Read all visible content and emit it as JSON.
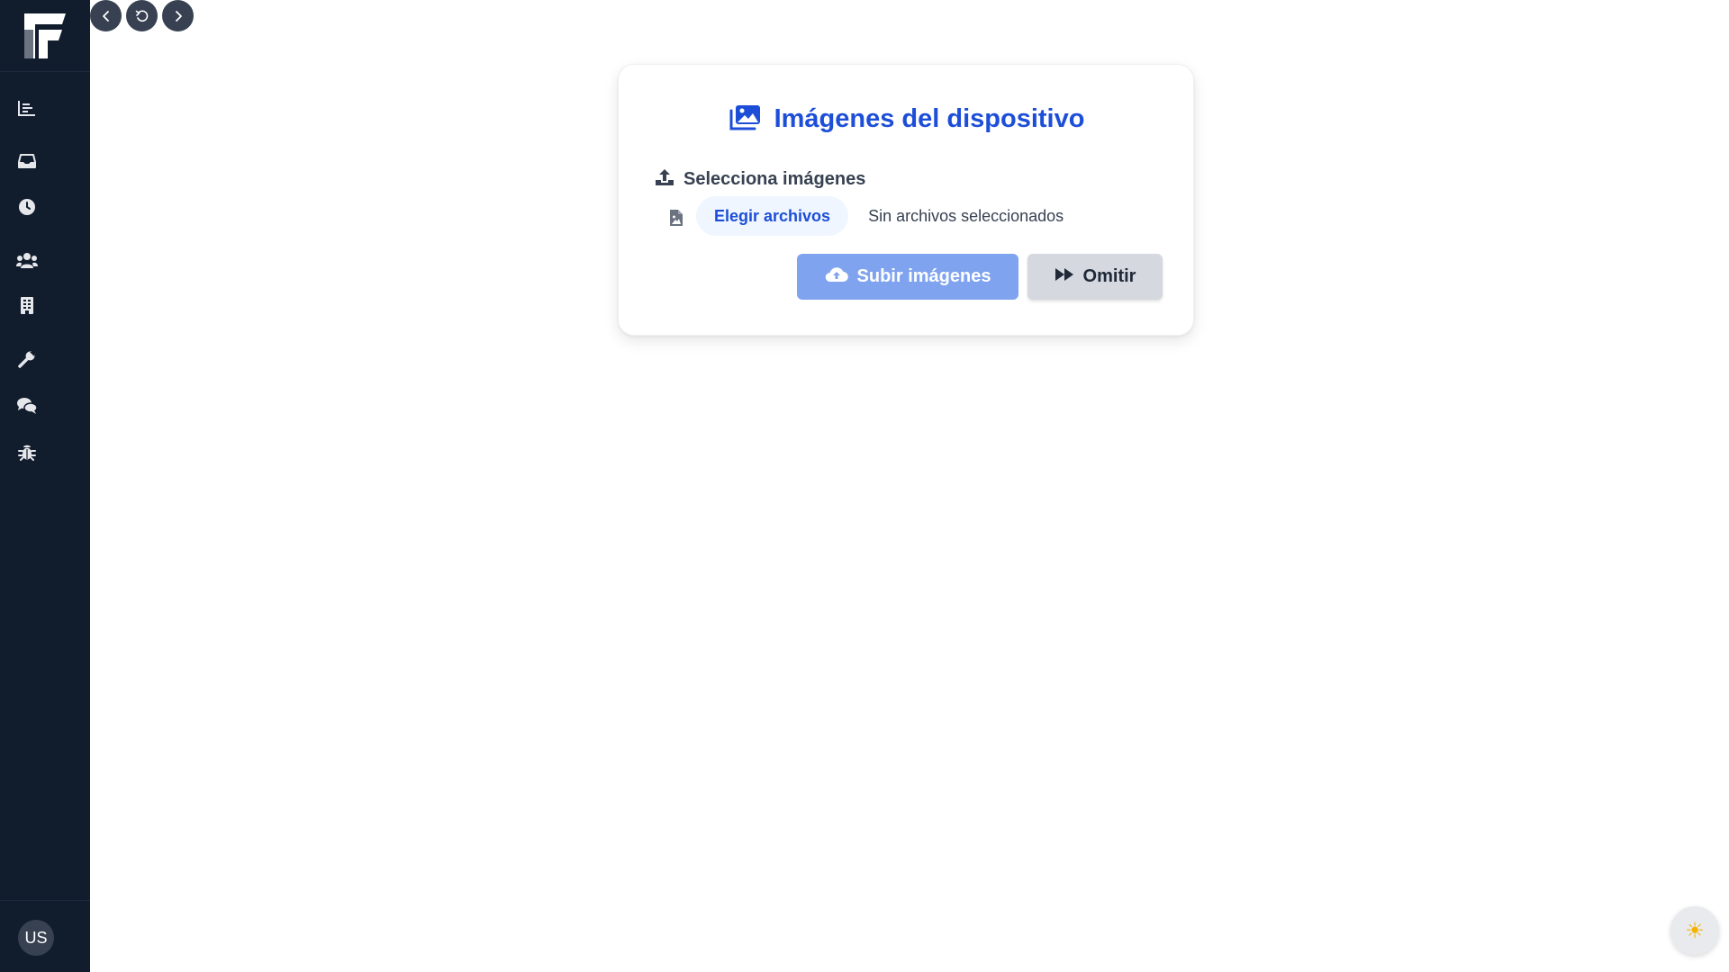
{
  "sidebar": {
    "items": [
      {
        "icon": "chart-bar-icon"
      },
      {
        "icon": "inbox-icon"
      },
      {
        "icon": "clock-icon"
      },
      {
        "icon": "users-icon"
      },
      {
        "icon": "building-icon"
      },
      {
        "icon": "wrench-icon"
      },
      {
        "icon": "comments-icon"
      },
      {
        "icon": "bug-icon"
      }
    ],
    "avatar_initials": "US"
  },
  "card": {
    "title": "Imágenes del dispositivo",
    "section_label": "Selecciona imágenes",
    "choose_files_label": "Elegir archivos",
    "no_files_text": "Sin archivos seleccionados",
    "upload_button_label": "Subir imágenes",
    "skip_button_label": "Omitir"
  },
  "theme_toggle_glyph": "☀",
  "colors": {
    "sidebar_bg": "#111c2d",
    "accent": "#1d4ed8",
    "upload_button_bg": "#7fa3ef",
    "skip_button_bg": "#d5d8de"
  }
}
